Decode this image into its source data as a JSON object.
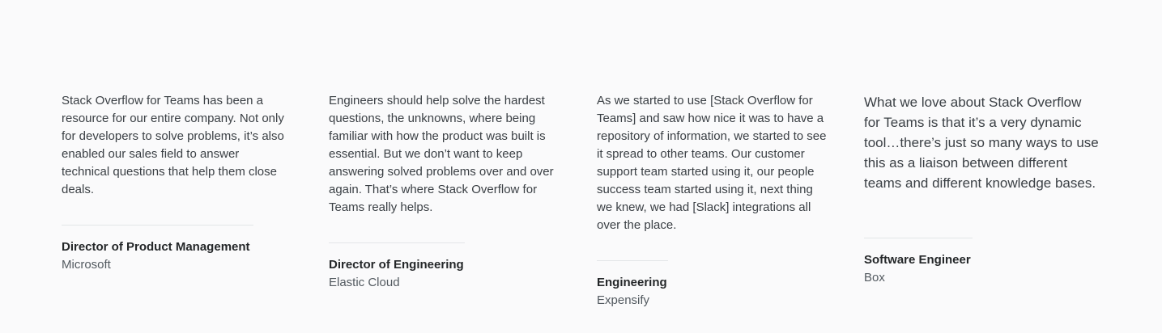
{
  "testimonials": [
    {
      "quote": "Stack Overflow for Teams has been a resource for our entire company. Not only for developers to solve problems, it’s also enabled our sales field to answer technical questions that help them close deals.",
      "role": "Director of Product Management",
      "company": "Microsoft"
    },
    {
      "quote": "Engineers should help solve the hardest questions, the unknowns, where being familiar with how the product was built is essential. But we don’t want to keep answering solved problems over and over again. That’s where Stack Overflow for Teams really helps.",
      "role": "Director of Engineering",
      "company": "Elastic Cloud"
    },
    {
      "quote": "As we started to use [Stack Overflow for Teams] and saw how nice it was to have a repository of information, we started to see it spread to other teams. Our customer support team started using it, our people success team started using it, next thing we knew, we had [Slack] integrations all over the place.",
      "role": "Engineering",
      "company": "Expensify"
    },
    {
      "quote": "What we love about Stack Overflow for Teams is that it’s a very dynamic tool…there’s just so many ways to use this as a liaison between different teams and different knowledge bases.",
      "role": "Software Engineer",
      "company": "Box"
    }
  ]
}
